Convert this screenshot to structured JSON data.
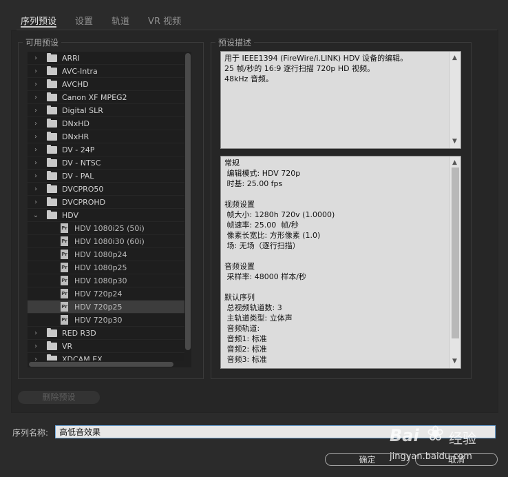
{
  "tabs": [
    "序列预设",
    "设置",
    "轨道",
    "VR 视频"
  ],
  "presets_title": "可用预设",
  "desc_title": "预设描述",
  "tree": [
    {
      "label": "ARRI",
      "type": "folder",
      "expanded": false
    },
    {
      "label": "AVC-Intra",
      "type": "folder",
      "expanded": false
    },
    {
      "label": "AVCHD",
      "type": "folder",
      "expanded": false
    },
    {
      "label": "Canon XF MPEG2",
      "type": "folder",
      "expanded": false
    },
    {
      "label": "Digital SLR",
      "type": "folder",
      "expanded": false
    },
    {
      "label": "DNxHD",
      "type": "folder",
      "expanded": false
    },
    {
      "label": "DNxHR",
      "type": "folder",
      "expanded": false
    },
    {
      "label": "DV - 24P",
      "type": "folder",
      "expanded": false
    },
    {
      "label": "DV - NTSC",
      "type": "folder",
      "expanded": false
    },
    {
      "label": "DV - PAL",
      "type": "folder",
      "expanded": false
    },
    {
      "label": "DVCPRO50",
      "type": "folder",
      "expanded": false
    },
    {
      "label": "DVCPROHD",
      "type": "folder",
      "expanded": false
    },
    {
      "label": "HDV",
      "type": "folder",
      "expanded": true
    },
    {
      "label": "HDV 1080i25 (50i)",
      "type": "preset"
    },
    {
      "label": "HDV 1080i30 (60i)",
      "type": "preset"
    },
    {
      "label": "HDV 1080p24",
      "type": "preset"
    },
    {
      "label": "HDV 1080p25",
      "type": "preset"
    },
    {
      "label": "HDV 1080p30",
      "type": "preset"
    },
    {
      "label": "HDV 720p24",
      "type": "preset"
    },
    {
      "label": "HDV 720p25",
      "type": "preset",
      "selected": true
    },
    {
      "label": "HDV 720p30",
      "type": "preset"
    },
    {
      "label": "RED R3D",
      "type": "folder",
      "expanded": false
    },
    {
      "label": "VR",
      "type": "folder",
      "expanded": false
    },
    {
      "label": "XDCAM EX",
      "type": "folder",
      "expanded": false
    }
  ],
  "preset_icon_text": "Pr",
  "description": "用于 IEEE1394 (FireWire/i.LINK) HDV 设备的编辑。\n25 帧/秒的 16:9 逐行扫描 720p HD 视频。\n48kHz 音频。",
  "details": "常规\n 编辑模式: HDV 720p\n 时基: 25.00 fps\n\n视频设置\n 帧大小: 1280h 720v (1.0000)\n 帧速率: 25.00  帧/秒\n 像素长宽比: 方形像素 (1.0)\n 场: 无场（逐行扫描）\n\n音频设置\n 采样率: 48000 样本/秒\n\n默认序列\n 总视频轨道数: 3\n 主轨道类型: 立体声\n 音频轨道:\n 音频1: 标准\n 音频2: 标准\n 音频3: 标准",
  "delete_button": "删除预设",
  "sequence_name_label": "序列名称:",
  "sequence_name_value": "高低音效果",
  "ok_button": "确定",
  "cancel_button": "取消",
  "watermark": {
    "brand": "Bai",
    "site": "经验",
    "url": "jingyan.baidu.com"
  }
}
